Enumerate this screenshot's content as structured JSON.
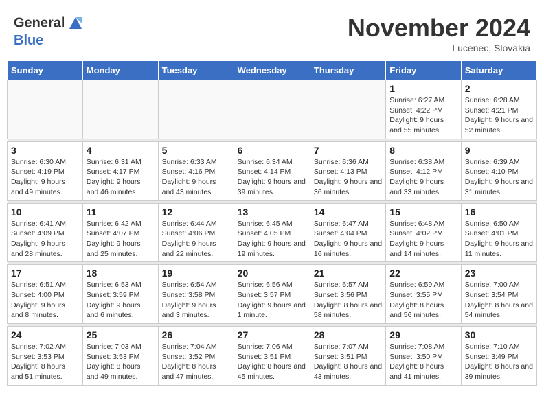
{
  "logo": {
    "line1": "General",
    "line2": "Blue"
  },
  "title": "November 2024",
  "location": "Lucenec, Slovakia",
  "weekdays": [
    "Sunday",
    "Monday",
    "Tuesday",
    "Wednesday",
    "Thursday",
    "Friday",
    "Saturday"
  ],
  "weeks": [
    [
      {
        "day": "",
        "info": ""
      },
      {
        "day": "",
        "info": ""
      },
      {
        "day": "",
        "info": ""
      },
      {
        "day": "",
        "info": ""
      },
      {
        "day": "",
        "info": ""
      },
      {
        "day": "1",
        "info": "Sunrise: 6:27 AM\nSunset: 4:22 PM\nDaylight: 9 hours and 55 minutes."
      },
      {
        "day": "2",
        "info": "Sunrise: 6:28 AM\nSunset: 4:21 PM\nDaylight: 9 hours and 52 minutes."
      }
    ],
    [
      {
        "day": "3",
        "info": "Sunrise: 6:30 AM\nSunset: 4:19 PM\nDaylight: 9 hours and 49 minutes."
      },
      {
        "day": "4",
        "info": "Sunrise: 6:31 AM\nSunset: 4:17 PM\nDaylight: 9 hours and 46 minutes."
      },
      {
        "day": "5",
        "info": "Sunrise: 6:33 AM\nSunset: 4:16 PM\nDaylight: 9 hours and 43 minutes."
      },
      {
        "day": "6",
        "info": "Sunrise: 6:34 AM\nSunset: 4:14 PM\nDaylight: 9 hours and 39 minutes."
      },
      {
        "day": "7",
        "info": "Sunrise: 6:36 AM\nSunset: 4:13 PM\nDaylight: 9 hours and 36 minutes."
      },
      {
        "day": "8",
        "info": "Sunrise: 6:38 AM\nSunset: 4:12 PM\nDaylight: 9 hours and 33 minutes."
      },
      {
        "day": "9",
        "info": "Sunrise: 6:39 AM\nSunset: 4:10 PM\nDaylight: 9 hours and 31 minutes."
      }
    ],
    [
      {
        "day": "10",
        "info": "Sunrise: 6:41 AM\nSunset: 4:09 PM\nDaylight: 9 hours and 28 minutes."
      },
      {
        "day": "11",
        "info": "Sunrise: 6:42 AM\nSunset: 4:07 PM\nDaylight: 9 hours and 25 minutes."
      },
      {
        "day": "12",
        "info": "Sunrise: 6:44 AM\nSunset: 4:06 PM\nDaylight: 9 hours and 22 minutes."
      },
      {
        "day": "13",
        "info": "Sunrise: 6:45 AM\nSunset: 4:05 PM\nDaylight: 9 hours and 19 minutes."
      },
      {
        "day": "14",
        "info": "Sunrise: 6:47 AM\nSunset: 4:04 PM\nDaylight: 9 hours and 16 minutes."
      },
      {
        "day": "15",
        "info": "Sunrise: 6:48 AM\nSunset: 4:02 PM\nDaylight: 9 hours and 14 minutes."
      },
      {
        "day": "16",
        "info": "Sunrise: 6:50 AM\nSunset: 4:01 PM\nDaylight: 9 hours and 11 minutes."
      }
    ],
    [
      {
        "day": "17",
        "info": "Sunrise: 6:51 AM\nSunset: 4:00 PM\nDaylight: 9 hours and 8 minutes."
      },
      {
        "day": "18",
        "info": "Sunrise: 6:53 AM\nSunset: 3:59 PM\nDaylight: 9 hours and 6 minutes."
      },
      {
        "day": "19",
        "info": "Sunrise: 6:54 AM\nSunset: 3:58 PM\nDaylight: 9 hours and 3 minutes."
      },
      {
        "day": "20",
        "info": "Sunrise: 6:56 AM\nSunset: 3:57 PM\nDaylight: 9 hours and 1 minute."
      },
      {
        "day": "21",
        "info": "Sunrise: 6:57 AM\nSunset: 3:56 PM\nDaylight: 8 hours and 58 minutes."
      },
      {
        "day": "22",
        "info": "Sunrise: 6:59 AM\nSunset: 3:55 PM\nDaylight: 8 hours and 56 minutes."
      },
      {
        "day": "23",
        "info": "Sunrise: 7:00 AM\nSunset: 3:54 PM\nDaylight: 8 hours and 54 minutes."
      }
    ],
    [
      {
        "day": "24",
        "info": "Sunrise: 7:02 AM\nSunset: 3:53 PM\nDaylight: 8 hours and 51 minutes."
      },
      {
        "day": "25",
        "info": "Sunrise: 7:03 AM\nSunset: 3:53 PM\nDaylight: 8 hours and 49 minutes."
      },
      {
        "day": "26",
        "info": "Sunrise: 7:04 AM\nSunset: 3:52 PM\nDaylight: 8 hours and 47 minutes."
      },
      {
        "day": "27",
        "info": "Sunrise: 7:06 AM\nSunset: 3:51 PM\nDaylight: 8 hours and 45 minutes."
      },
      {
        "day": "28",
        "info": "Sunrise: 7:07 AM\nSunset: 3:51 PM\nDaylight: 8 hours and 43 minutes."
      },
      {
        "day": "29",
        "info": "Sunrise: 7:08 AM\nSunset: 3:50 PM\nDaylight: 8 hours and 41 minutes."
      },
      {
        "day": "30",
        "info": "Sunrise: 7:10 AM\nSunset: 3:49 PM\nDaylight: 8 hours and 39 minutes."
      }
    ]
  ]
}
